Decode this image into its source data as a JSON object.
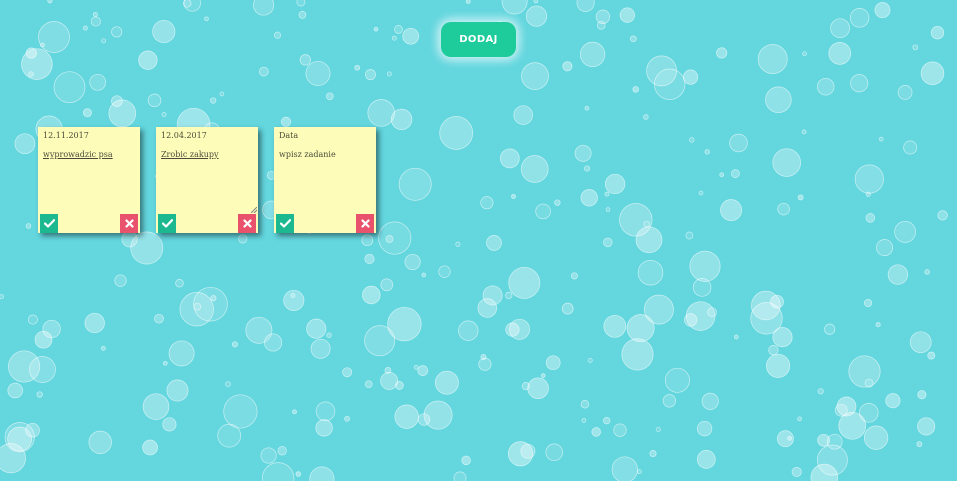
{
  "app": {
    "add_label": "DODAJ",
    "background_color": "#63d6de",
    "accent_color": "#1ecb9a",
    "delete_color": "#e8526c",
    "note_color": "#fdfdb9"
  },
  "notes": [
    {
      "date": "12.11.2017",
      "text": "wyprowadzic psa",
      "done_icon": "check-icon",
      "delete_icon": "x-icon"
    },
    {
      "date": "12.04.2017",
      "text": "Zrobic zakupy",
      "done_icon": "check-icon",
      "delete_icon": "x-icon"
    },
    {
      "date": "Data",
      "text": "wpisz zadanie",
      "done_icon": "check-icon",
      "delete_icon": "x-icon"
    }
  ]
}
